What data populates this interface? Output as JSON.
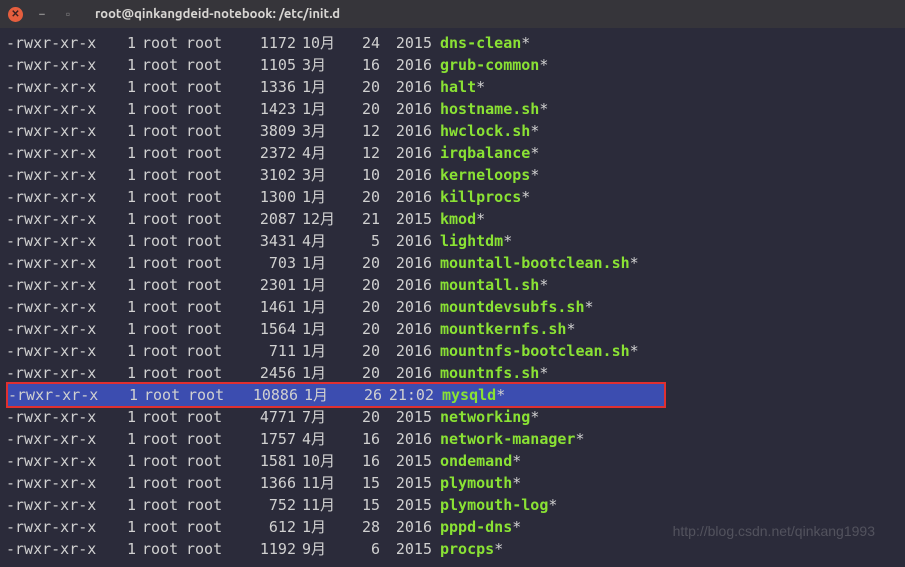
{
  "window": {
    "title": "root@qinkangdeid-notebook: /etc/init.d"
  },
  "rows": [
    {
      "perm": "-rwxr-xr-x",
      "links": "1",
      "owner": "root",
      "group": "root",
      "size": "1172",
      "month": "10月",
      "day": "24",
      "year": "2015",
      "name": "dns-clean",
      "hl": false
    },
    {
      "perm": "-rwxr-xr-x",
      "links": "1",
      "owner": "root",
      "group": "root",
      "size": "1105",
      "month": "3月",
      "day": "16",
      "year": "2016",
      "name": "grub-common",
      "hl": false
    },
    {
      "perm": "-rwxr-xr-x",
      "links": "1",
      "owner": "root",
      "group": "root",
      "size": "1336",
      "month": "1月",
      "day": "20",
      "year": "2016",
      "name": "halt",
      "hl": false
    },
    {
      "perm": "-rwxr-xr-x",
      "links": "1",
      "owner": "root",
      "group": "root",
      "size": "1423",
      "month": "1月",
      "day": "20",
      "year": "2016",
      "name": "hostname.sh",
      "hl": false
    },
    {
      "perm": "-rwxr-xr-x",
      "links": "1",
      "owner": "root",
      "group": "root",
      "size": "3809",
      "month": "3月",
      "day": "12",
      "year": "2016",
      "name": "hwclock.sh",
      "hl": false
    },
    {
      "perm": "-rwxr-xr-x",
      "links": "1",
      "owner": "root",
      "group": "root",
      "size": "2372",
      "month": "4月",
      "day": "12",
      "year": "2016",
      "name": "irqbalance",
      "hl": false
    },
    {
      "perm": "-rwxr-xr-x",
      "links": "1",
      "owner": "root",
      "group": "root",
      "size": "3102",
      "month": "3月",
      "day": "10",
      "year": "2016",
      "name": "kerneloops",
      "hl": false
    },
    {
      "perm": "-rwxr-xr-x",
      "links": "1",
      "owner": "root",
      "group": "root",
      "size": "1300",
      "month": "1月",
      "day": "20",
      "year": "2016",
      "name": "killprocs",
      "hl": false
    },
    {
      "perm": "-rwxr-xr-x",
      "links": "1",
      "owner": "root",
      "group": "root",
      "size": "2087",
      "month": "12月",
      "day": "21",
      "year": "2015",
      "name": "kmod",
      "hl": false
    },
    {
      "perm": "-rwxr-xr-x",
      "links": "1",
      "owner": "root",
      "group": "root",
      "size": "3431",
      "month": "4月",
      "day": "5",
      "year": "2016",
      "name": "lightdm",
      "hl": false
    },
    {
      "perm": "-rwxr-xr-x",
      "links": "1",
      "owner": "root",
      "group": "root",
      "size": "703",
      "month": "1月",
      "day": "20",
      "year": "2016",
      "name": "mountall-bootclean.sh",
      "hl": false
    },
    {
      "perm": "-rwxr-xr-x",
      "links": "1",
      "owner": "root",
      "group": "root",
      "size": "2301",
      "month": "1月",
      "day": "20",
      "year": "2016",
      "name": "mountall.sh",
      "hl": false
    },
    {
      "perm": "-rwxr-xr-x",
      "links": "1",
      "owner": "root",
      "group": "root",
      "size": "1461",
      "month": "1月",
      "day": "20",
      "year": "2016",
      "name": "mountdevsubfs.sh",
      "hl": false
    },
    {
      "perm": "-rwxr-xr-x",
      "links": "1",
      "owner": "root",
      "group": "root",
      "size": "1564",
      "month": "1月",
      "day": "20",
      "year": "2016",
      "name": "mountkernfs.sh",
      "hl": false
    },
    {
      "perm": "-rwxr-xr-x",
      "links": "1",
      "owner": "root",
      "group": "root",
      "size": "711",
      "month": "1月",
      "day": "20",
      "year": "2016",
      "name": "mountnfs-bootclean.sh",
      "hl": false
    },
    {
      "perm": "-rwxr-xr-x",
      "links": "1",
      "owner": "root",
      "group": "root",
      "size": "2456",
      "month": "1月",
      "day": "20",
      "year": "2016",
      "name": "mountnfs.sh",
      "hl": false
    },
    {
      "perm": "-rwxr-xr-x",
      "links": "1",
      "owner": "root",
      "group": "root",
      "size": "10886",
      "month": "1月",
      "day": "26",
      "year": "21:02",
      "name": "mysqld",
      "hl": true
    },
    {
      "perm": "-rwxr-xr-x",
      "links": "1",
      "owner": "root",
      "group": "root",
      "size": "4771",
      "month": "7月",
      "day": "20",
      "year": "2015",
      "name": "networking",
      "hl": false
    },
    {
      "perm": "-rwxr-xr-x",
      "links": "1",
      "owner": "root",
      "group": "root",
      "size": "1757",
      "month": "4月",
      "day": "16",
      "year": "2016",
      "name": "network-manager",
      "hl": false
    },
    {
      "perm": "-rwxr-xr-x",
      "links": "1",
      "owner": "root",
      "group": "root",
      "size": "1581",
      "month": "10月",
      "day": "16",
      "year": "2015",
      "name": "ondemand",
      "hl": false
    },
    {
      "perm": "-rwxr-xr-x",
      "links": "1",
      "owner": "root",
      "group": "root",
      "size": "1366",
      "month": "11月",
      "day": "15",
      "year": "2015",
      "name": "plymouth",
      "hl": false
    },
    {
      "perm": "-rwxr-xr-x",
      "links": "1",
      "owner": "root",
      "group": "root",
      "size": "752",
      "month": "11月",
      "day": "15",
      "year": "2015",
      "name": "plymouth-log",
      "hl": false
    },
    {
      "perm": "-rwxr-xr-x",
      "links": "1",
      "owner": "root",
      "group": "root",
      "size": "612",
      "month": "1月",
      "day": "28",
      "year": "2016",
      "name": "pppd-dns",
      "hl": false
    },
    {
      "perm": "-rwxr-xr-x",
      "links": "1",
      "owner": "root",
      "group": "root",
      "size": "1192",
      "month": "9月",
      "day": "6",
      "year": "2015",
      "name": "procps",
      "hl": false
    }
  ],
  "watermark": "http://blog.csdn.net/qinkang1993"
}
